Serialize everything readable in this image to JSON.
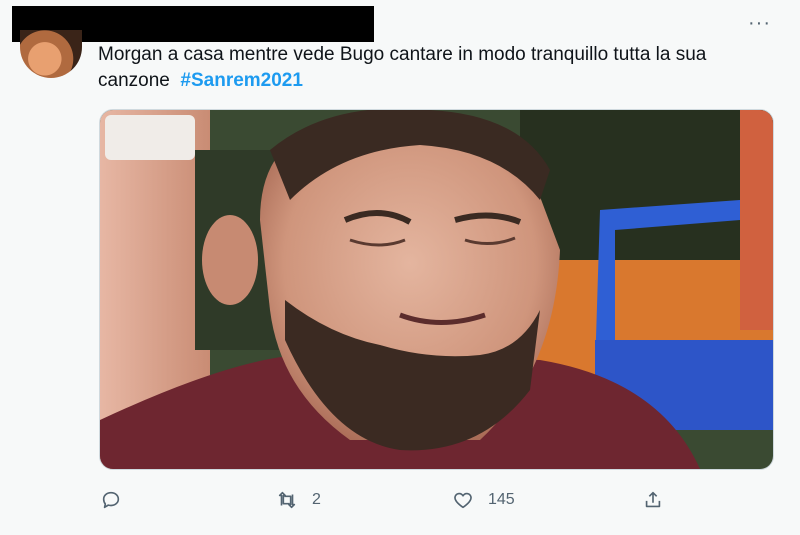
{
  "tweet": {
    "text": "Morgan a casa mentre vede Bugo cantare in modo tranquillo tutta la sua canzone",
    "hashtag": "#Sanrem2021",
    "more_label": "···"
  },
  "actions": {
    "reply_icon": "reply-icon",
    "retweet_icon": "retweet-icon",
    "retweet_count": "2",
    "like_icon": "heart-icon",
    "like_count": "145",
    "share_icon": "share-icon"
  },
  "colors": {
    "hashtag": "#1d9bf0",
    "icon": "#536471"
  }
}
